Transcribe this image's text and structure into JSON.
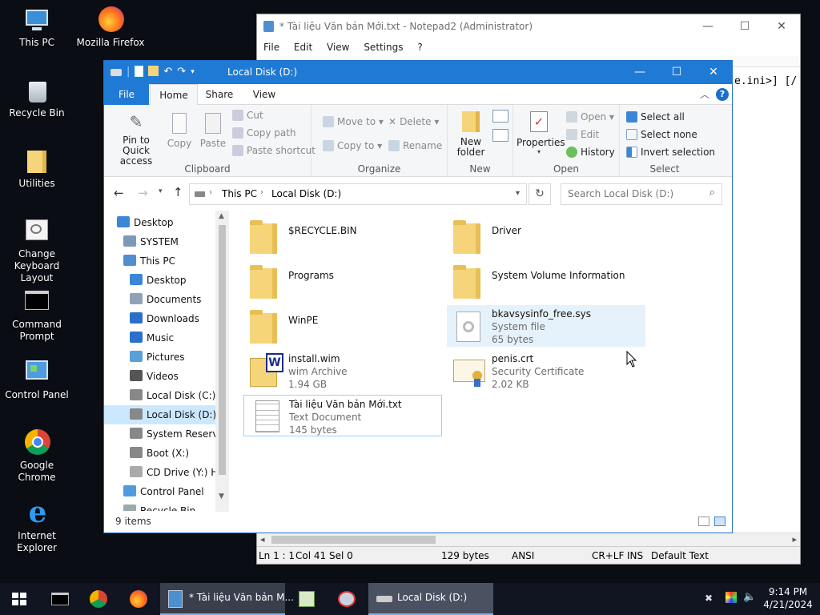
{
  "desktop": {
    "icons": [
      {
        "label": "This PC",
        "icon": "this-pc-icon"
      },
      {
        "label": "Mozilla Firefox",
        "icon": "firefox-icon"
      },
      {
        "label": "Recycle Bin",
        "icon": "recycle-bin-icon"
      },
      {
        "label": "Utilities",
        "icon": "folder-icon"
      },
      {
        "label": "Change Keyboard Layout",
        "icon": "keyboard-layout-icon"
      },
      {
        "label": "Command Prompt",
        "icon": "command-prompt-icon"
      },
      {
        "label": "Control Panel",
        "icon": "control-panel-icon"
      },
      {
        "label": "Google Chrome",
        "icon": "chrome-icon"
      },
      {
        "label": "Internet Explorer",
        "icon": "internet-explorer-icon"
      }
    ]
  },
  "notepad": {
    "title": "* Tài liệu Văn bản Mới.txt - Notepad2 (Administrator)",
    "menu": [
      "File",
      "Edit",
      "View",
      "Settings",
      "?"
    ],
    "visible_text": "e.ini>] [/",
    "status": {
      "position": "Ln 1 : 1",
      "col": "Col 41",
      "sel": "Sel 0",
      "size": "129 bytes",
      "encoding": "ANSI",
      "eol": "CR+LF",
      "ins": "INS",
      "scheme": "Default Text"
    }
  },
  "explorer": {
    "title": "Local Disk (D:)",
    "tabs": {
      "file": "File",
      "home": "Home",
      "share": "Share",
      "view": "View"
    },
    "ribbon": {
      "clipboard": {
        "label": "Clipboard",
        "pin": "Pin to Quick access",
        "copy": "Copy",
        "paste": "Paste",
        "cut": "Cut",
        "copy_path": "Copy path",
        "paste_shortcut": "Paste shortcut"
      },
      "organize": {
        "label": "Organize",
        "move_to": "Move to",
        "copy_to": "Copy to",
        "delete": "Delete",
        "rename": "Rename"
      },
      "new": {
        "label": "New",
        "new_folder": "New folder"
      },
      "open": {
        "label": "Open",
        "properties": "Properties",
        "open": "Open",
        "edit": "Edit",
        "history": "History"
      },
      "select": {
        "label": "Select",
        "select_all": "Select all",
        "select_none": "Select none",
        "invert": "Invert selection"
      }
    },
    "address": {
      "crumb1": "This PC",
      "crumb2": "Local Disk (D:)",
      "search_placeholder": "Search Local Disk (D:)"
    },
    "nav": [
      {
        "label": "Desktop",
        "indent": 0
      },
      {
        "label": "SYSTEM",
        "indent": 1
      },
      {
        "label": "This PC",
        "indent": 1
      },
      {
        "label": "Desktop",
        "indent": 2
      },
      {
        "label": "Documents",
        "indent": 2
      },
      {
        "label": "Downloads",
        "indent": 2
      },
      {
        "label": "Music",
        "indent": 2
      },
      {
        "label": "Pictures",
        "indent": 2
      },
      {
        "label": "Videos",
        "indent": 2
      },
      {
        "label": "Local Disk (C:)",
        "indent": 2
      },
      {
        "label": "Local Disk (D:)",
        "indent": 2
      },
      {
        "label": "System Reserve",
        "indent": 2
      },
      {
        "label": "Boot (X:)",
        "indent": 2
      },
      {
        "label": "CD Drive (Y:) H",
        "indent": 2
      },
      {
        "label": "Control Panel",
        "indent": 1
      },
      {
        "label": "Recycle Bin",
        "indent": 1
      }
    ],
    "files": [
      {
        "name": "$RECYCLE.BIN",
        "type": "",
        "size": ""
      },
      {
        "name": "Driver",
        "type": "",
        "size": ""
      },
      {
        "name": "Programs",
        "type": "",
        "size": ""
      },
      {
        "name": "System Volume Information",
        "type": "",
        "size": ""
      },
      {
        "name": "WinPE",
        "type": "",
        "size": ""
      },
      {
        "name": "bkavsysinfo_free.sys",
        "type": "System file",
        "size": "65 bytes"
      },
      {
        "name": "install.wim",
        "type": "wim Archive",
        "size": "1.94 GB"
      },
      {
        "name": "penis.crt",
        "type": "Security Certificate",
        "size": "2.02 KB"
      },
      {
        "name": "Tài liệu Văn bản Mới.txt",
        "type": "Text Document",
        "size": "145 bytes"
      }
    ],
    "status": "9 items"
  },
  "taskbar": {
    "notepad_btn": "* Tài liệu Văn bản M...",
    "explorer_btn": "Local Disk (D:)",
    "time": "9:14 PM",
    "date": "4/21/2024"
  }
}
